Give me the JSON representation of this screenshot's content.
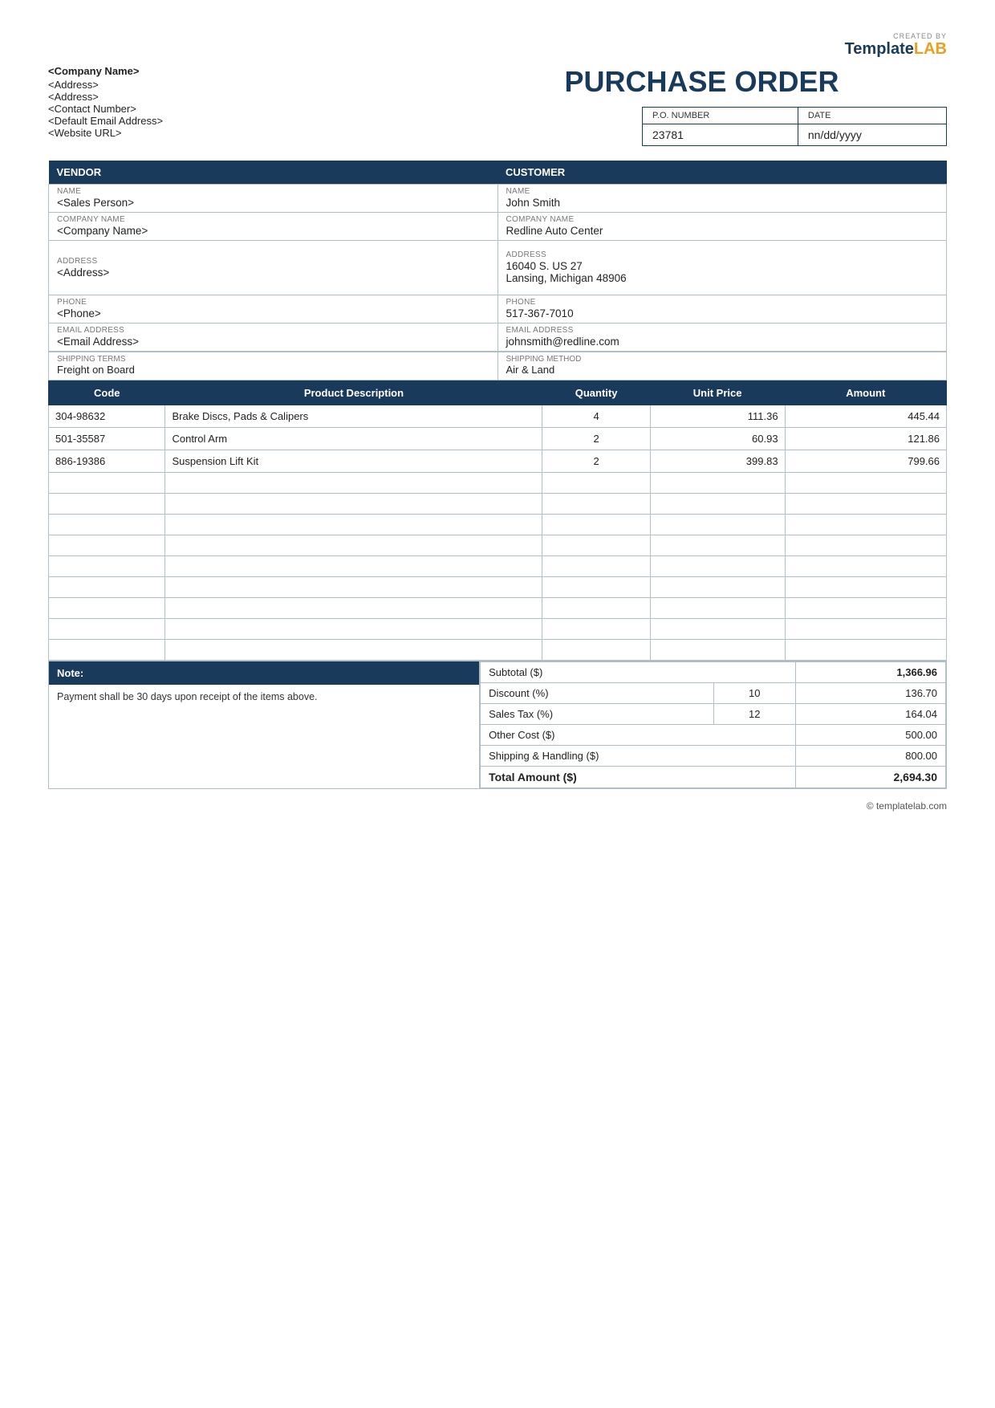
{
  "logo": {
    "created_by": "CREATED BY",
    "template": "Template",
    "lab": "LAB"
  },
  "company": {
    "name": "<Company Name>",
    "address1": "<Address>",
    "address2": "<Address>",
    "contact": "<Contact Number>",
    "email": "<Default Email Address>",
    "website": "<Website URL>"
  },
  "page_title": "PURCHASE ORDER",
  "po_fields": {
    "po_number_label": "P.O. NUMBER",
    "date_label": "DATE",
    "po_number": "23781",
    "date": "nn/dd/yyyy"
  },
  "vendor_section": {
    "header": "VENDOR",
    "name_label": "NAME",
    "name_value": "<Sales Person>",
    "company_label": "COMPANY NAME",
    "company_value": "<Company Name>",
    "address_label": "ADDRESS",
    "address_value": "<Address>",
    "phone_label": "PHONE",
    "phone_value": "<Phone>",
    "email_label": "EMAIL ADDRESS",
    "email_value": "<Email Address>"
  },
  "customer_section": {
    "header": "CUSTOMER",
    "name_label": "NAME",
    "name_value": "John Smith",
    "company_label": "COMPANY NAME",
    "company_value": "Redline Auto Center",
    "address_label": "ADDRESS",
    "address_value": "16040 S. US 27\nLansing, Michigan 48906",
    "phone_label": "PHONE",
    "phone_value": "517-367-7010",
    "email_label": "EMAIL ADDRESS",
    "email_value": "johnsmith@redline.com"
  },
  "shipping": {
    "terms_label": "SHIPPING TERMS",
    "terms_value": "Freight on Board",
    "method_label": "SHIPPING METHOD",
    "method_value": "Air & Land"
  },
  "items_table": {
    "headers": {
      "code": "Code",
      "description": "Product Description",
      "quantity": "Quantity",
      "unit_price": "Unit Price",
      "amount": "Amount"
    },
    "rows": [
      {
        "code": "304-98632",
        "description": "Brake Discs, Pads & Calipers",
        "quantity": "4",
        "unit_price": "111.36",
        "amount": "445.44"
      },
      {
        "code": "501-35587",
        "description": "Control Arm",
        "quantity": "2",
        "unit_price": "60.93",
        "amount": "121.86"
      },
      {
        "code": "886-19386",
        "description": "Suspension Lift Kit",
        "quantity": "2",
        "unit_price": "399.83",
        "amount": "799.66"
      },
      {
        "code": "",
        "description": "",
        "quantity": "",
        "unit_price": "",
        "amount": ""
      },
      {
        "code": "",
        "description": "",
        "quantity": "",
        "unit_price": "",
        "amount": ""
      },
      {
        "code": "",
        "description": "",
        "quantity": "",
        "unit_price": "",
        "amount": ""
      },
      {
        "code": "",
        "description": "",
        "quantity": "",
        "unit_price": "",
        "amount": ""
      },
      {
        "code": "",
        "description": "",
        "quantity": "",
        "unit_price": "",
        "amount": ""
      },
      {
        "code": "",
        "description": "",
        "quantity": "",
        "unit_price": "",
        "amount": ""
      },
      {
        "code": "",
        "description": "",
        "quantity": "",
        "unit_price": "",
        "amount": ""
      },
      {
        "code": "",
        "description": "",
        "quantity": "",
        "unit_price": "",
        "amount": ""
      },
      {
        "code": "",
        "description": "",
        "quantity": "",
        "unit_price": "",
        "amount": ""
      }
    ]
  },
  "note": {
    "header": "Note:",
    "text": "Payment shall be 30 days upon receipt of the items above."
  },
  "totals": {
    "subtotal_label": "Subtotal ($)",
    "subtotal_value": "1,366.96",
    "discount_label": "Discount (%)",
    "discount_pct": "10",
    "discount_value": "136.70",
    "tax_label": "Sales Tax (%)",
    "tax_pct": "12",
    "tax_value": "164.04",
    "other_label": "Other Cost ($)",
    "other_value": "500.00",
    "shipping_label": "Shipping & Handling ($)",
    "shipping_value": "800.00",
    "total_label": "Total Amount ($)",
    "total_value": "2,694.30"
  },
  "footer": {
    "text": "© templatelab.com"
  }
}
